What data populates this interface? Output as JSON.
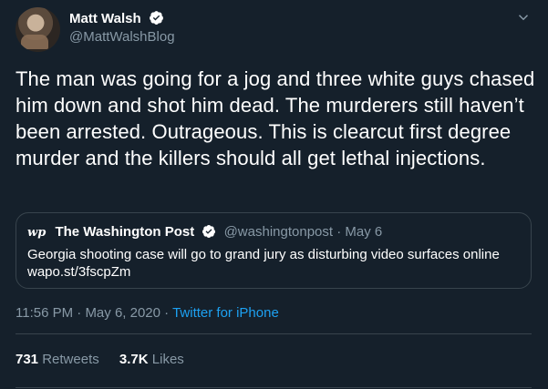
{
  "author": {
    "display_name": "Matt Walsh",
    "handle": "@MattWalshBlog",
    "verified": true
  },
  "tweet": {
    "text": "The man was going for a jog and three white guys chased him down and shot him dead. The murderers still haven’t been arrested. Outrageous. This is clearcut first degree murder and the killers should all get lethal injections."
  },
  "quoted": {
    "logo_text": "wp",
    "name": "The Washington Post",
    "handle": "@washingtonpost",
    "separator": "·",
    "date": "May 6",
    "text": "Georgia shooting case will go to grand jury as disturbing video surfaces online wapo.st/3fscpZm"
  },
  "meta": {
    "time": "11:56 PM",
    "separator1": " · ",
    "date": "May 6, 2020",
    "separator2": " · ",
    "source": "Twitter for iPhone"
  },
  "stats": {
    "retweets_count": "731",
    "retweets_label": "Retweets",
    "likes_count": "3.7K",
    "likes_label": "Likes"
  },
  "colors": {
    "background": "#15202b",
    "text": "#ffffff",
    "secondary": "#8899a6",
    "accent": "#1da1f2",
    "border": "#38444d"
  },
  "icons": [
    "verified-badge-icon",
    "chevron-down-icon"
  ]
}
